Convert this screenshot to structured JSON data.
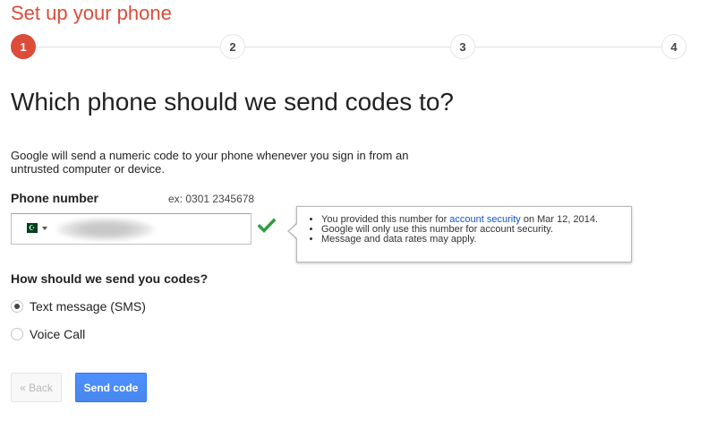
{
  "header": {
    "title": "Set up your phone"
  },
  "stepper": {
    "steps": [
      "1",
      "2",
      "3",
      "4"
    ],
    "current_step": 1
  },
  "main": {
    "heading": "Which phone should we send codes to?",
    "description": "Google will send a numeric code to your phone whenever you sign in from an untrusted computer or device."
  },
  "phone": {
    "label": "Phone number",
    "example": "ex: 0301 2345678",
    "country_icon": "pakistan-flag-icon",
    "value": "",
    "valid_icon": "checkmark-icon",
    "valid_color": "#2e9e3e"
  },
  "tooltip": {
    "line1_before": "You provided this number for ",
    "line1_link": "account security",
    "line1_after": " on Mar 12, 2014.",
    "line2": "Google will only use this number for account security.",
    "line3": "Message and data rates may apply."
  },
  "delivery": {
    "question": "How should we send you codes?",
    "options": [
      {
        "label": "Text message (SMS)",
        "selected": true
      },
      {
        "label": "Voice Call",
        "selected": false
      }
    ]
  },
  "buttons": {
    "back": "« Back",
    "send": "Send code"
  },
  "colors": {
    "accent_red": "#dd4b39",
    "primary_blue": "#4d90fe",
    "link_blue": "#1155cc"
  }
}
